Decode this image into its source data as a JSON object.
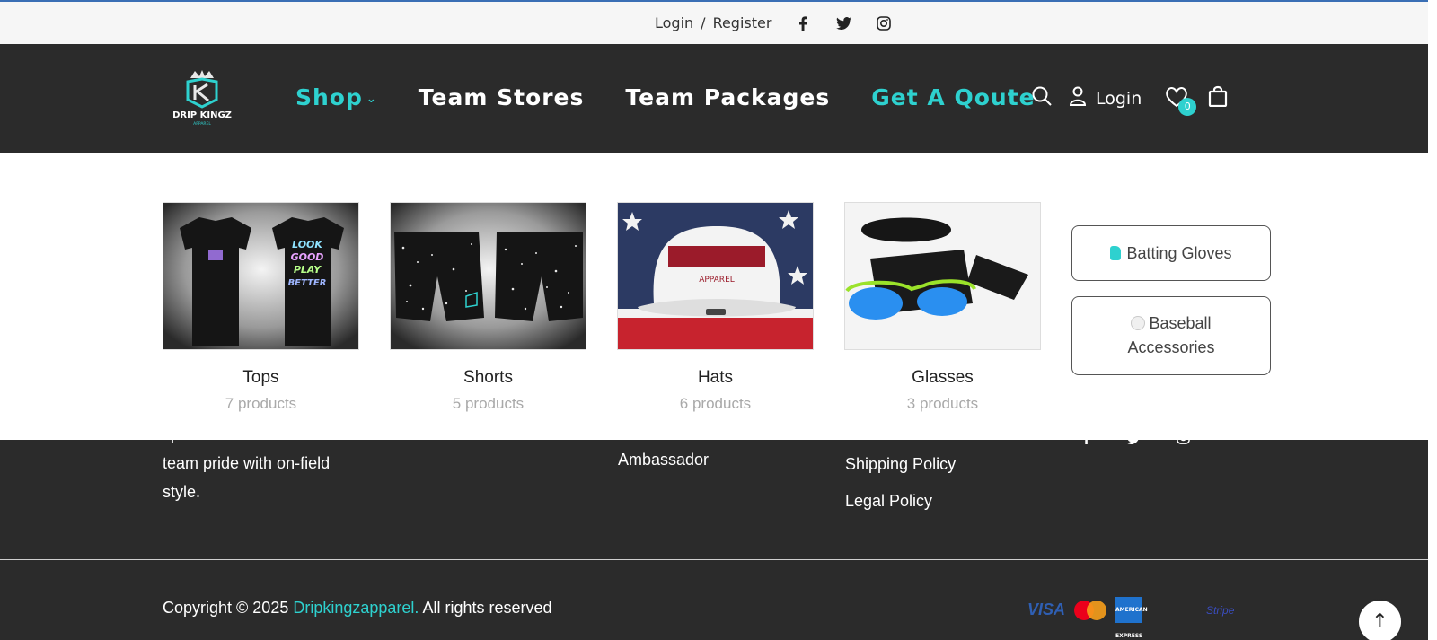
{
  "topbar": {
    "login": "Login",
    "separator": "/",
    "register": "Register",
    "social_icons": [
      "facebook-icon",
      "twitter-icon",
      "instagram-icon"
    ]
  },
  "header": {
    "logo_text": "DRIP KINGZ",
    "logo_sub": "APPAREL",
    "nav": {
      "shop": "Shop",
      "team_stores": "Team Stores",
      "team_packages": "Team Packages",
      "get_quote": "Get A Qoute"
    },
    "login": "Login",
    "wishlist_count": "0"
  },
  "dropdown": {
    "categories": [
      {
        "name": "Tops",
        "count": "7 products",
        "image": "t-shirts front and back with LOOK GOOD PLAY BETTER print"
      },
      {
        "name": "Shorts",
        "count": "5 products",
        "image": "black speckled shorts"
      },
      {
        "name": "Hats",
        "count": "6 products",
        "image": "white trucker hat on american flag"
      },
      {
        "name": "Glasses",
        "count": "3 products",
        "image": "sport sunglasses with case and pouch"
      }
    ],
    "side_links": {
      "batting_gloves": "Batting Gloves",
      "baseball_accessories": "Baseball Accessories"
    },
    "tshirt_print": [
      "LOOK",
      "GOOD",
      "PLAY",
      "BETTER"
    ],
    "hat_print": "APPAREL"
  },
  "footer": {
    "about_lines": [
      "sportswear that blends",
      "team pride with on-field",
      "style."
    ],
    "ambassador": "Ambassador",
    "shipping_policy": "Shipping Policy",
    "legal_policy": "Legal Policy",
    "copyright_prefix": "Copyright © 2025",
    "brand": "Dripkingzapparel.",
    "copyright_suffix": "All rights reserved",
    "payments": {
      "visa": "VISA",
      "amex": "AMERICAN EXPRESS",
      "stripe": "Stripe"
    }
  },
  "colors": {
    "accent": "#2ed1cf",
    "dark": "#2b2b2b",
    "muted": "#a9a9a9"
  }
}
